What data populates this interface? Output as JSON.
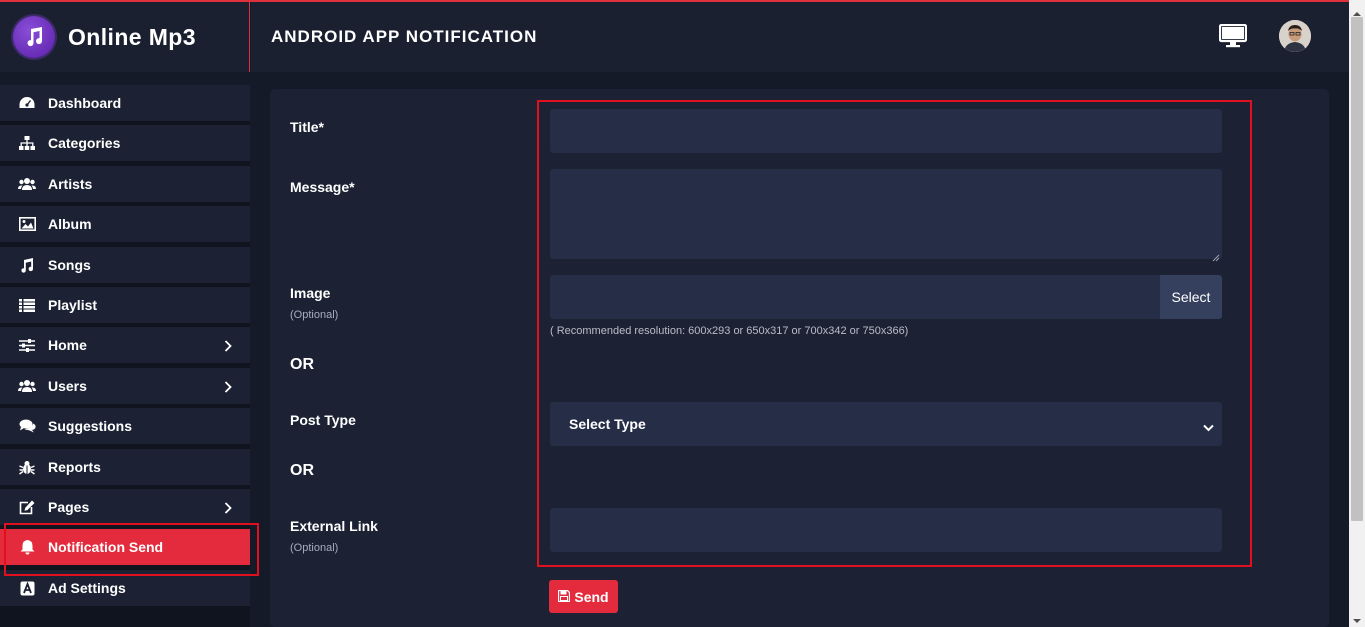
{
  "brand": {
    "name": "Online Mp3"
  },
  "header": {
    "title": "ANDROID APP NOTIFICATION"
  },
  "sidebar": {
    "items": [
      {
        "label": "Dashboard",
        "icon": "dashboard-icon"
      },
      {
        "label": "Categories",
        "icon": "sitemap-icon"
      },
      {
        "label": "Artists",
        "icon": "users-icon"
      },
      {
        "label": "Album",
        "icon": "image-icon"
      },
      {
        "label": "Songs",
        "icon": "music-icon"
      },
      {
        "label": "Playlist",
        "icon": "list-icon"
      },
      {
        "label": "Home",
        "icon": "sliders-icon"
      },
      {
        "label": "Users",
        "icon": "users-icon"
      },
      {
        "label": "Suggestions",
        "icon": "comments-icon"
      },
      {
        "label": "Reports",
        "icon": "bug-icon"
      },
      {
        "label": "Pages",
        "icon": "edit-icon"
      },
      {
        "label": "Notification Send",
        "icon": "bell-icon"
      },
      {
        "label": "Ad Settings",
        "icon": "ad-icon"
      }
    ],
    "active": "Notification Send"
  },
  "form": {
    "title_label": "Title*",
    "title_value": "",
    "message_label": "Message*",
    "message_value": "",
    "image_label": "Image",
    "image_optional": "(Optional)",
    "image_value": "",
    "select_button": "Select",
    "image_hint": "( Recommended resolution: 600x293 or 650x317 or 700x342 or 750x366)",
    "or_1": "OR",
    "post_type_label": "Post Type",
    "post_type_selected": "Select Type",
    "or_2": "OR",
    "external_link_label": "External Link",
    "external_link_optional": "(Optional)",
    "external_link_value": "",
    "send_button": "Send"
  },
  "colors": {
    "accent": "#e32b3d",
    "panel": "#1c2233",
    "input": "#252d47",
    "background": "#151a28"
  }
}
